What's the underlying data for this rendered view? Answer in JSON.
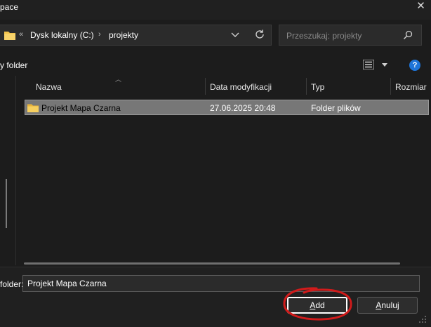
{
  "window": {
    "title": "pace",
    "close_glyph": "✕"
  },
  "address": {
    "sep": "«",
    "crumbs": [
      "Dysk lokalny (C:)",
      "projekty"
    ],
    "crumb_sep": "›"
  },
  "search": {
    "placeholder": "Przeszukaj: projekty"
  },
  "toolbar": {
    "left_label": "y folder",
    "help_glyph": "?"
  },
  "columns": [
    {
      "label": "Nazwa"
    },
    {
      "label": "Data modyfikacji"
    },
    {
      "label": "Typ"
    },
    {
      "label": "Rozmiar"
    }
  ],
  "rows": [
    {
      "name": "Projekt Mapa Czarna",
      "modified": "27.06.2025 20:48",
      "type": "Folder plików",
      "selected": true
    }
  ],
  "footer": {
    "field_label": "folder:",
    "field_value": "Projekt Mapa Czarna",
    "add_label": "Add",
    "cancel_label": "Anuluj"
  },
  "colors": {
    "accent_help": "#1d74d8",
    "annotation": "#d11b1b",
    "folder": "#f3c34b"
  }
}
